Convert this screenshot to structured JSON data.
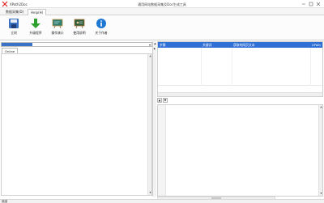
{
  "window": {
    "app_tab": "XPath2Doc",
    "title": "通用网站数据采集及Doc生成工具"
  },
  "ribbon_tabs": [
    {
      "label": "数据采集(D)",
      "active": false
    },
    {
      "label": "Help(H)",
      "active": true
    }
  ],
  "ribbon": {
    "buttons": [
      {
        "label": "立刻",
        "icon": "disk-icon"
      },
      {
        "label": "升级程序",
        "icon": "download-arrow-icon"
      },
      {
        "label": "操作演示",
        "icon": "presentation-board-icon"
      },
      {
        "label": "使用说明",
        "icon": "chalkboard-icon"
      },
      {
        "label": "关于作者",
        "icon": "info-icon"
      }
    ]
  },
  "left": {
    "select_value": "",
    "tab_label": "Online"
  },
  "grid": {
    "headers": [
      "步骤",
      "关键词",
      "获取的网页文本",
      "XPath"
    ]
  },
  "status": {
    "text": "就绪"
  },
  "colors": {
    "accent": "#2f6fd6",
    "selection": "#3a72c8"
  }
}
